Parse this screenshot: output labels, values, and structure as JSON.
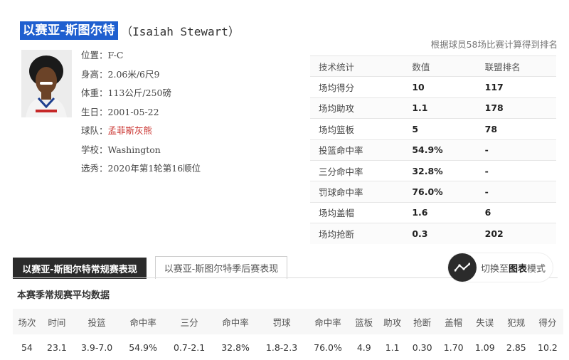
{
  "player": {
    "name_cn": "以赛亚-斯图尔特",
    "name_en": "（Isaiah Stewart）",
    "info": [
      {
        "label": "位置：",
        "value": "F-C"
      },
      {
        "label": "身高：",
        "value": "2.06米/6尺9"
      },
      {
        "label": "体重：",
        "value": "113公斤/250磅"
      },
      {
        "label": "生日：",
        "value": "2001-05-22"
      },
      {
        "label": "球队：",
        "value": "孟菲斯灰熊"
      },
      {
        "label": "学校：",
        "value": "Washington"
      },
      {
        "label": "选秀：",
        "value": "2020年第1轮第16顺位"
      }
    ]
  },
  "rank_note": "根据球员58场比赛计算得到排名",
  "stats_table": {
    "headers": [
      "技术统计",
      "数值",
      "联盟排名"
    ],
    "rows": [
      [
        "场均得分",
        "10",
        "117"
      ],
      [
        "场均助攻",
        "1.1",
        "178"
      ],
      [
        "场均篮板",
        "5",
        "78"
      ],
      [
        "投篮命中率",
        "54.9%",
        "-"
      ],
      [
        "三分命中率",
        "32.8%",
        "-"
      ],
      [
        "罚球命中率",
        "76.0%",
        "-"
      ],
      [
        "场均盖帽",
        "1.6",
        "6"
      ],
      [
        "场均抢断",
        "0.3",
        "202"
      ]
    ]
  },
  "tabs": {
    "regular": "以赛亚-斯图尔特常规赛表现",
    "playoffs": "以赛亚-斯图尔特季后赛表现"
  },
  "chart_switch": {
    "prefix": "切换至",
    "bold": "图表",
    "suffix": "模式"
  },
  "season_avg": {
    "title": "本赛季常规赛平均数据",
    "headers": [
      "场次",
      "时间",
      "投篮",
      "命中率",
      "三分",
      "命中率",
      "罚球",
      "命中率",
      "篮板",
      "助攻",
      "抢断",
      "盖帽",
      "失误",
      "犯规",
      "得分"
    ],
    "values": [
      "54",
      "23.1",
      "3.9-7.0",
      "54.9%",
      "0.7-2.1",
      "32.8%",
      "1.8-2.3",
      "76.0%",
      "4.9",
      "1.1",
      "0.30",
      "1.70",
      "1.09",
      "2.85",
      "10.2"
    ]
  },
  "colors": {
    "highlight": "#1f5fcf",
    "team": "#c9302c",
    "dark_tab": "#2b2b2b"
  }
}
